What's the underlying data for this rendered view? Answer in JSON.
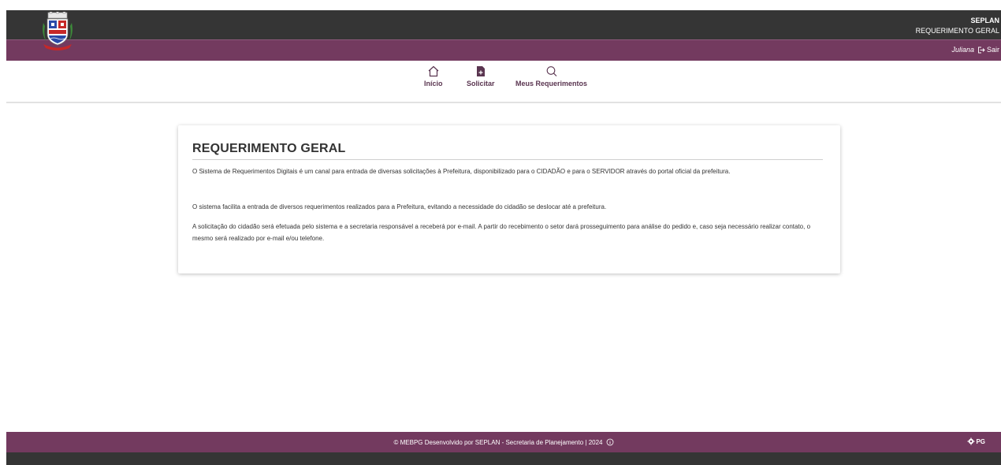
{
  "header": {
    "app_name": "SEPLAN",
    "app_subtitle": "REQUERIMENTO GERAL"
  },
  "user": {
    "name": "Juliana",
    "logout_label": "Sair"
  },
  "nav": {
    "items": [
      {
        "label": "Início",
        "icon": "home-icon"
      },
      {
        "label": "Solicitar",
        "icon": "document-add-icon"
      },
      {
        "label": "Meus Requerimentos",
        "icon": "search-icon"
      }
    ]
  },
  "content": {
    "title": "REQUERIMENTO GERAL",
    "paragraphs": [
      "O Sistema de Requerimentos Digitais é um canal para entrada de diversas solicitações à Prefeitura, disponibilizado para o CIDADÃO e para o SERVIDOR através do portal oficial da prefeitura.",
      "O sistema facilita a entrada de diversos requerimentos realizados para a Prefeitura, evitando a necessidade do cidadão se deslocar até a prefeitura.",
      "A solicitação do cidadão será efetuada pelo sistema e a secretaria responsável a receberá por e-mail. A partir do recebimento o setor dará prosseguimento para análise do pedido e, caso seja necessário realizar contato, o mesmo será realizado por e-mail e/ou telefone."
    ]
  },
  "footer": {
    "copyright": "© MEBPG Desenvolvido por SEPLAN - Secretaria de Planejamento | 2024",
    "brand": "PG"
  },
  "colors": {
    "primary": "#733a5f",
    "dark": "#353535",
    "nav_text": "#5a3550"
  }
}
